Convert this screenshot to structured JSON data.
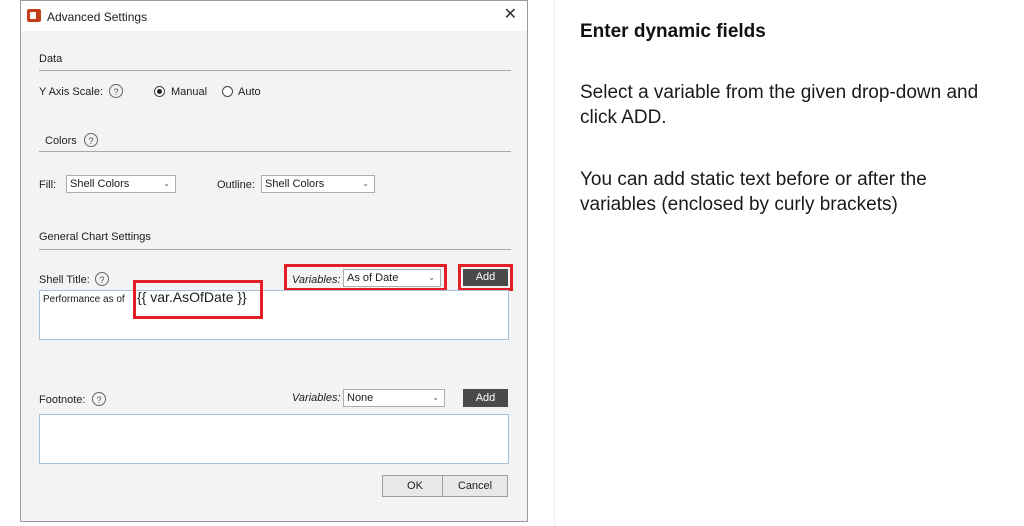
{
  "dialog": {
    "title": "Advanced Settings",
    "close_glyph": "✕",
    "data_section": {
      "heading": "Data",
      "y_axis_label": "Y Axis Scale:",
      "options": [
        {
          "label": "Manual",
          "selected": true
        },
        {
          "label": "Auto",
          "selected": false
        }
      ]
    },
    "colors_section": {
      "heading": "Colors",
      "fill_label": "Fill:",
      "fill_value": "Shell Colors",
      "outline_label": "Outline:",
      "outline_value": "Shell Colors"
    },
    "general_section": {
      "heading": "General Chart Settings",
      "shell_title_label": "Shell Title:",
      "variables_label": "Variables:",
      "title_variable_value": "As of Date",
      "add_label": "Add",
      "title_text_prefix": "Performance as of",
      "title_text_variable": "{{ var.AsOfDate }}",
      "footnote_label": "Footnote:",
      "footnote_variable_value": "None"
    },
    "help_glyph": "?",
    "chevron_glyph": "⌄",
    "ok_label": "OK",
    "cancel_label": "Cancel",
    "highlight_color": "#e41e26"
  },
  "instructions": {
    "title": "Enter dynamic fields",
    "para1": "Select a variable from the given drop-down and click ADD.",
    "para2": "You can add static text before or after the variables (enclosed by curly brackets)"
  }
}
